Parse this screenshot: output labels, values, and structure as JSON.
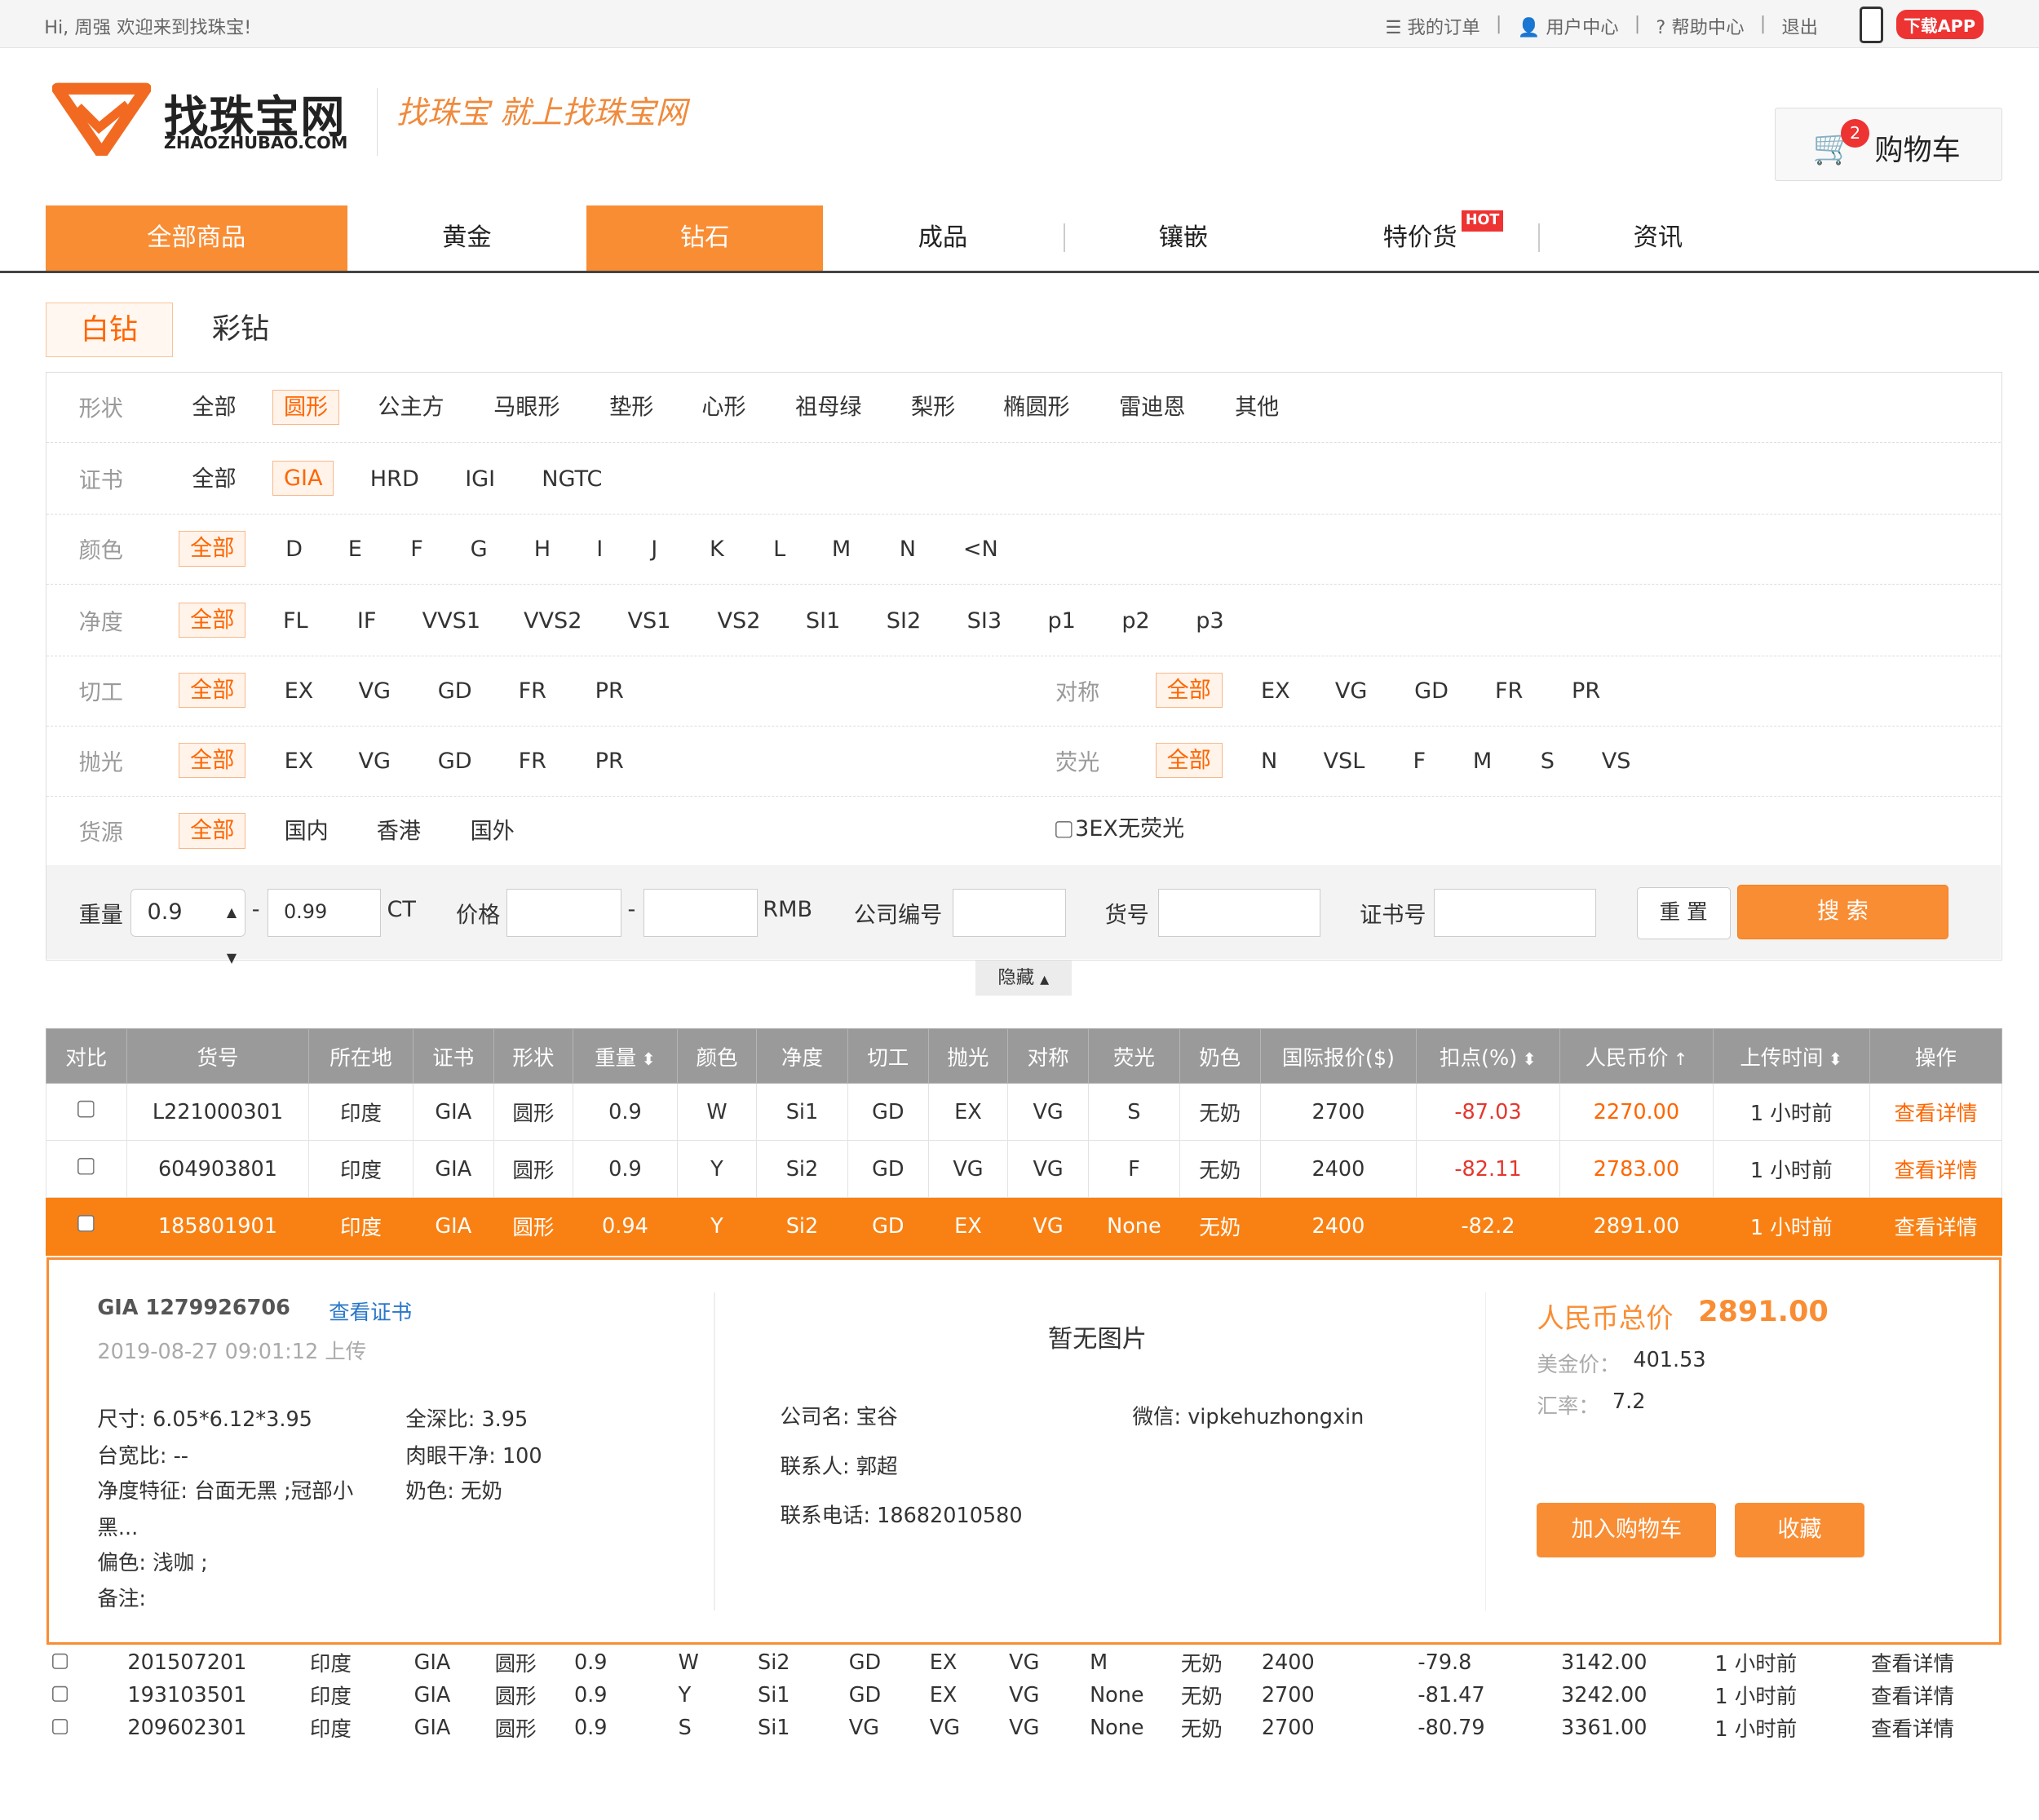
{
  "topbar": {
    "greeting": "Hi, 周强  欢迎来到找珠宝!",
    "links": [
      "我的订单",
      "用户中心",
      "帮助中心",
      "退出"
    ],
    "app_label": "下载APP"
  },
  "header": {
    "logo_cn": "找珠宝网",
    "logo_en": "ZHAOZHUBAO.COM",
    "slogan": "找珠宝  就上找珠宝网",
    "cart_label": "购物车",
    "cart_count": "2"
  },
  "nav": {
    "items": [
      "全部商品",
      "黄金",
      "钻石",
      "成品",
      "镶嵌",
      "特价货",
      "资讯"
    ],
    "hot_badge": "HOT"
  },
  "subtabs": [
    "白钻",
    "彩钻"
  ],
  "filters": {
    "shape": {
      "label": "形状",
      "options": [
        "全部",
        "圆形",
        "公主方",
        "马眼形",
        "垫形",
        "心形",
        "祖母绿",
        "梨形",
        "椭圆形",
        "雷迪恩",
        "其他"
      ]
    },
    "cert": {
      "label": "证书",
      "options": [
        "全部",
        "GIA",
        "HRD",
        "IGI",
        "NGTC"
      ]
    },
    "color": {
      "label": "颜色",
      "options": [
        "全部",
        "D",
        "E",
        "F",
        "G",
        "H",
        "I",
        "J",
        "K",
        "L",
        "M",
        "N",
        "<N"
      ]
    },
    "clarity": {
      "label": "净度",
      "options": [
        "全部",
        "FL",
        "IF",
        "VVS1",
        "VVS2",
        "VS1",
        "VS2",
        "SI1",
        "SI2",
        "SI3",
        "p1",
        "p2",
        "p3"
      ]
    },
    "cut": {
      "label": "切工",
      "options": [
        "全部",
        "EX",
        "VG",
        "GD",
        "FR",
        "PR"
      ]
    },
    "symmetry": {
      "label": "对称",
      "options": [
        "全部",
        "EX",
        "VG",
        "GD",
        "FR",
        "PR"
      ]
    },
    "polish": {
      "label": "抛光",
      "options": [
        "全部",
        "EX",
        "VG",
        "GD",
        "FR",
        "PR"
      ]
    },
    "fluor": {
      "label": "荧光",
      "options": [
        "全部",
        "N",
        "VSL",
        "F",
        "M",
        "S",
        "VS"
      ]
    },
    "source": {
      "label": "货源",
      "options": [
        "全部",
        "国内",
        "香港",
        "国外"
      ]
    },
    "ex3_label": "3EX无荧光",
    "weight_label": "重量",
    "weight_min": "0.9",
    "weight_max": "0.99",
    "weight_unit": "CT",
    "price_label": "价格",
    "price_unit": "RMB",
    "company_label": "公司编号",
    "goods_label": "货号",
    "cert_no_label": "证书号",
    "reset_label": "重 置",
    "search_label": "搜 索",
    "hide_label": "隐藏"
  },
  "table": {
    "headers": [
      "对比",
      "货号",
      "所在地",
      "证书",
      "形状",
      "重量",
      "颜色",
      "净度",
      "切工",
      "抛光",
      "对称",
      "荧光",
      "奶色",
      "国际报价($)",
      "扣点(%)",
      "人民币价",
      "上传时间",
      "操作"
    ],
    "rows_top": [
      [
        "L221000301",
        "印度",
        "GIA",
        "圆形",
        "0.9",
        "W",
        "Si1",
        "GD",
        "EX",
        "VG",
        "S",
        "无奶",
        "2700",
        "-87.03",
        "2270.00",
        "1 小时前",
        "查看详情"
      ],
      [
        "604903801",
        "印度",
        "GIA",
        "圆形",
        "0.9",
        "Y",
        "Si2",
        "GD",
        "VG",
        "VG",
        "F",
        "无奶",
        "2400",
        "-82.11",
        "2783.00",
        "1 小时前",
        "查看详情"
      ],
      [
        "185801901",
        "印度",
        "GIA",
        "圆形",
        "0.94",
        "Y",
        "Si2",
        "GD",
        "EX",
        "VG",
        "None",
        "无奶",
        "2400",
        "-82.2",
        "2891.00",
        "1 小时前",
        "查看详情"
      ]
    ],
    "rows_bottom": [
      [
        "201507201",
        "印度",
        "GIA",
        "圆形",
        "0.9",
        "W",
        "Si2",
        "GD",
        "EX",
        "VG",
        "M",
        "无奶",
        "2400",
        "-79.8",
        "3142.00",
        "1 小时前",
        "查看详情"
      ],
      [
        "193103501",
        "印度",
        "GIA",
        "圆形",
        "0.9",
        "Y",
        "Si1",
        "GD",
        "EX",
        "VG",
        "None",
        "无奶",
        "2700",
        "-81.47",
        "3242.00",
        "1 小时前",
        "查看详情"
      ],
      [
        "209602301",
        "印度",
        "GIA",
        "圆形",
        "0.9",
        "S",
        "Si1",
        "VG",
        "VG",
        "VG",
        "None",
        "无奶",
        "2700",
        "-80.79",
        "3361.00",
        "1 小时前",
        "查看详情"
      ]
    ]
  },
  "detail": {
    "cert": "GIA 1279926706",
    "view_cert": "查看证书",
    "uploaded": "2019-08-27 09:01:12 上传",
    "size": "尺寸:   6.05*6.12*3.95",
    "depth": "全深比:   3.95",
    "table_ratio": "台宽比:   --",
    "eye_clean": "肉眼干净:   100",
    "clarity_feat_1": "净度特征:   台面无黑 ;冠部小",
    "clarity_feat_2": "黑...",
    "milky": "奶色:   无奶",
    "tint": "偏色:   浅咖 ;",
    "remark": "备注:",
    "no_image": "暂无图片",
    "company": "公司名:  宝谷",
    "wechat": "微信:  vipkehuzhongxin",
    "contact": "联系人:  郭超",
    "phone": "联系电话:  18682010580",
    "total_label": "人民币总价",
    "total_value": "2891.00",
    "usd_label": "美金价：",
    "usd_value": "401.53",
    "rate_label": "汇率：",
    "rate_value": "7.2",
    "add_cart": "加入购物车",
    "favorite": "收藏"
  },
  "colors": {
    "accent": "#f98d33",
    "highlight_row": "#f98113",
    "discount": "#e4372e",
    "price": "#ff6600"
  }
}
